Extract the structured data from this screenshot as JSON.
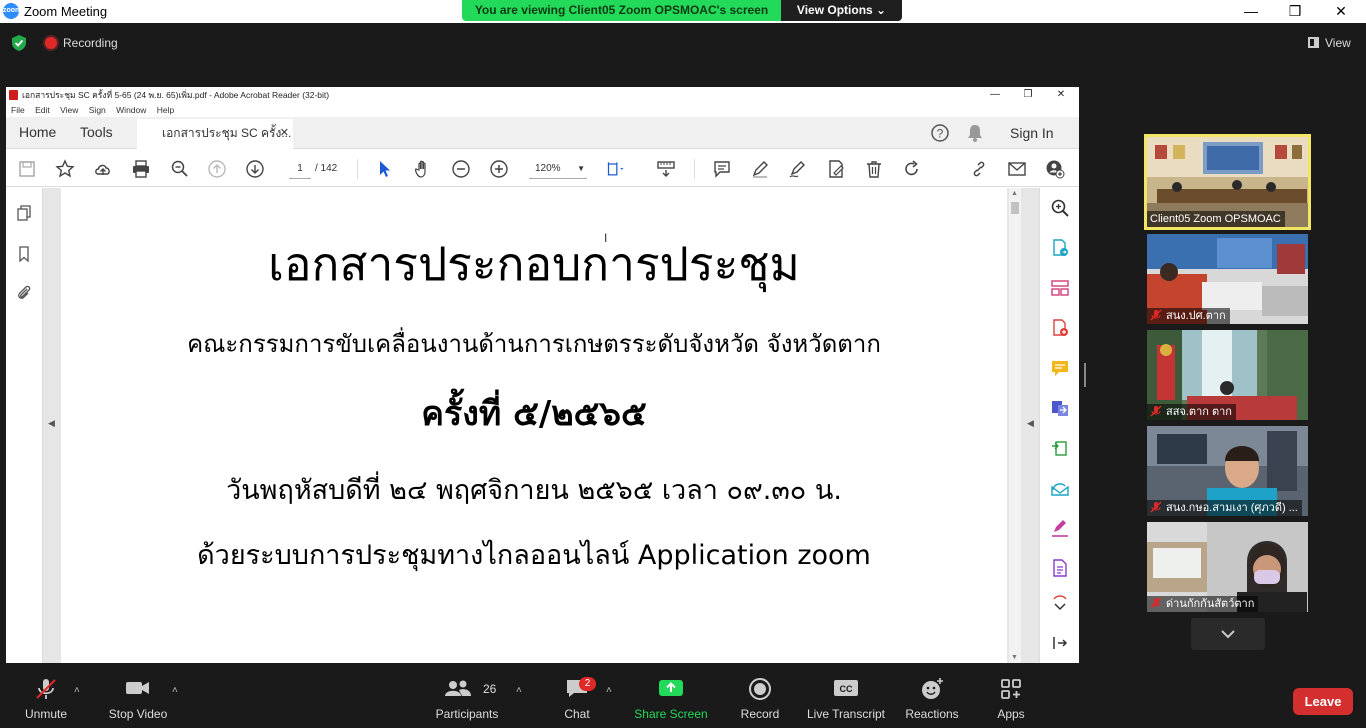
{
  "zoom": {
    "window_title": "Zoom Meeting",
    "app_icon_text": "zoom",
    "viewing_banner": "You are viewing Client05 Zoom OPSMOAC's screen",
    "view_options": "View Options ⌄",
    "recording_label": "Recording",
    "view_label": "View"
  },
  "acrobat": {
    "window_title": "เอกสารประชุม SC ครั้งที่ 5-65 (24 พ.ย. 65)เพิ่ม.pdf - Adobe Acrobat Reader (32-bit)",
    "menu": [
      "File",
      "Edit",
      "View",
      "Sign",
      "Window",
      "Help"
    ],
    "tab_home": "Home",
    "tab_tools": "Tools",
    "doc_tab": "เอกสารประชุม SC ครั้ง...",
    "sign_in": "Sign In",
    "page_current": "1",
    "page_total": "/  142",
    "zoom_level": "120%"
  },
  "document": {
    "line1": "เอกสารประกอบการประชุม",
    "line2": "คณะกรรมการขับเคลื่อนงานด้านการเกษตรระดับจังหวัด จังหวัดตาก",
    "line3": "ครั้งที่ ๕/๒๕๖๕",
    "line4": "วันพฤหัสบดีที่ ๒๔ พฤศจิกายน ๒๕๖๕ เวลา ๐๙.๓๐ น.",
    "line5": "ด้วยระบบการประชุมทางไกลออนไลน์ Application zoom"
  },
  "participants_strip": [
    {
      "name": "Client05 Zoom OPSMOAC",
      "muted": false,
      "active": true
    },
    {
      "name": "สนง.ปศ.ตาก",
      "muted": true,
      "active": false
    },
    {
      "name": "สสจ.ตาก ตาก",
      "muted": true,
      "active": false
    },
    {
      "name": "สนง.กษอ.สามเงา (ศุภวดี) ...",
      "muted": true,
      "active": false
    },
    {
      "name": "ด่านกักกันสัตว์ตาก",
      "muted": true,
      "active": false
    }
  ],
  "bottombar": {
    "unmute": "Unmute",
    "stop_video": "Stop Video",
    "participants": "Participants",
    "participants_count": "26",
    "chat": "Chat",
    "chat_badge": "2",
    "share_screen": "Share Screen",
    "record": "Record",
    "live_transcript": "Live Transcript",
    "reactions": "Reactions",
    "apps": "Apps",
    "leave": "Leave"
  },
  "colors": {
    "banner_green": "#23d959",
    "leave_red": "#d32f2f",
    "active_speaker": "#f3e564",
    "zoom_blue": "#2d8cff"
  }
}
